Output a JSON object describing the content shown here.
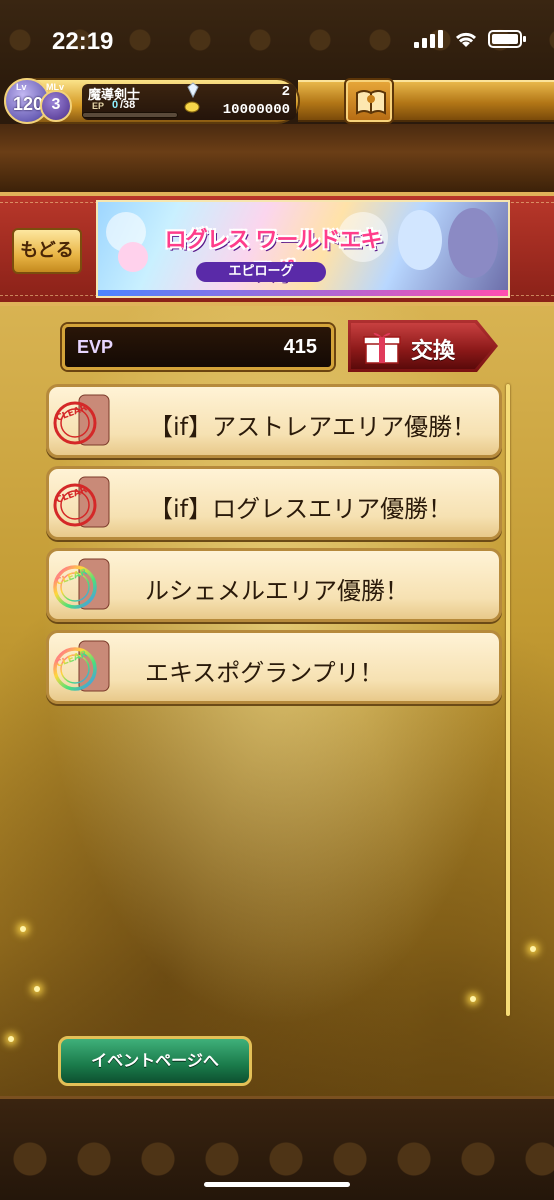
{
  "status_bar": {
    "time": "22:19"
  },
  "player": {
    "lv_label": "Lv",
    "level": "120",
    "mlv_label": "MLv",
    "master_level": "3",
    "job": "魔導剣士",
    "ep_label": "EP",
    "ep_current": "0",
    "ep_max": "/38",
    "ep_fill_fraction": 0,
    "gems": "2",
    "coins": "10000000"
  },
  "nav": {
    "back_label": "もどる"
  },
  "banner": {
    "title": "ログレス ワールドエキスポ",
    "subtitle": "エピローグ"
  },
  "evp": {
    "label": "EVP",
    "value": "415"
  },
  "exchange": {
    "label": "交換"
  },
  "missions": [
    {
      "label": "【if】アストレアエリア優勝！",
      "stamp": "clear-red"
    },
    {
      "label": "【if】ログレスエリア優勝！",
      "stamp": "clear-red"
    },
    {
      "label": "ルシェメルエリア優勝！",
      "stamp": "clear-rainbow"
    },
    {
      "label": "エキスポグランプリ！",
      "stamp": "clear-rainbow"
    }
  ],
  "footer": {
    "event_page_label": "イベントページへ"
  },
  "colors": {
    "accent_gold": "#d4a43a",
    "banner_red": "#b8372a",
    "button_green": "#1a7a4a"
  }
}
